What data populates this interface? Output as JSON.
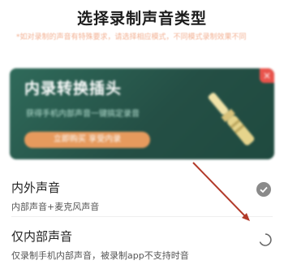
{
  "dialog": {
    "title": "选择录制声音类型",
    "notice": "*如对录制的声音有特殊要求，请选择相应模式，不同模式录制效果不同"
  },
  "banner": {
    "title": "内录转换插头",
    "subtitle": "获得手机内部声音一键搞定录音",
    "button": "立即购买 享受内录",
    "badge": "×",
    "colors": {
      "background": "#2a5e50",
      "accent": "#e69a5d"
    }
  },
  "options": [
    {
      "title": "内外声音",
      "subtitle": "内部声音+麦克风声音",
      "selected": true,
      "icon": "check-circle-icon"
    },
    {
      "title": "仅内部声音",
      "subtitle": "仅录制手机内部声音，被录制app不支持时音",
      "selected": false,
      "icon": "radio-loading-icon"
    }
  ],
  "annotation": {
    "color": "#b23a2a",
    "icon": "arrow-pointer"
  }
}
